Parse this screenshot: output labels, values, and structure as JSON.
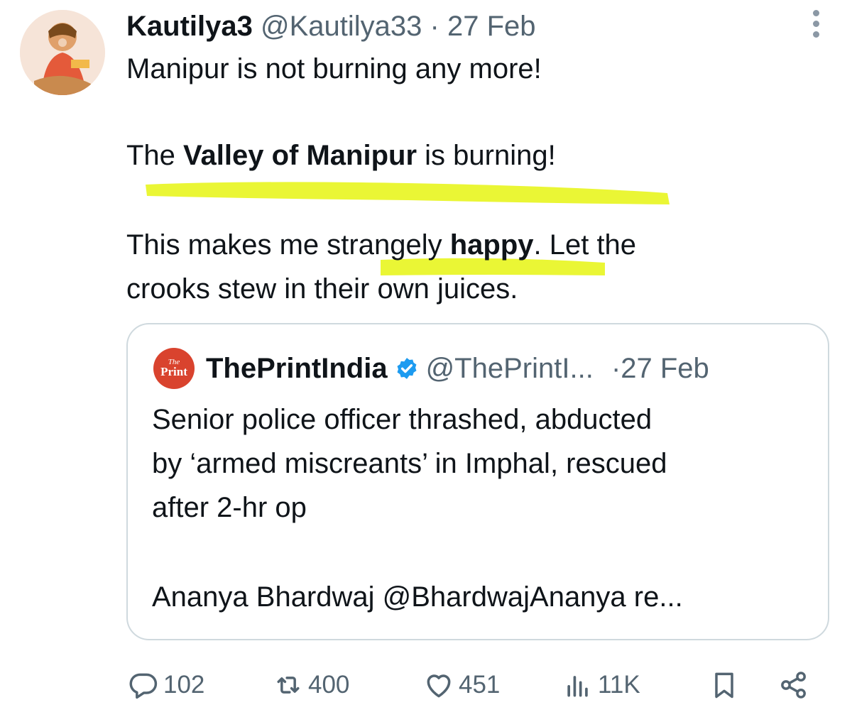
{
  "tweet": {
    "display_name": "Kautilya3",
    "handle": "@Kautilya33",
    "separator": "·",
    "date": "27 Feb",
    "lines": {
      "line1": "Manipur is not burning any more!",
      "line2_pre": "The ",
      "line2_bold": "Valley of Manipur",
      "line2_post": " is burning!",
      "line3_pre": "This makes me strangely ",
      "line3_bold": "happy",
      "line3_post": ". Let the",
      "line4": "crooks stew in their own juices."
    }
  },
  "quote": {
    "logo_text_top": "The",
    "logo_text_bottom": "Print",
    "display_name": "ThePrintIndia",
    "handle": "@ThePrintI...",
    "separator": "·",
    "date": "27 Feb",
    "lines": [
      "Senior police officer thrashed, abducted",
      "by ‘armed miscreants’ in Imphal, rescued",
      "after 2-hr op"
    ],
    "byline": "Ananya Bhardwaj @BhardwajAnanya re..."
  },
  "actions": {
    "replies": "102",
    "reposts": "400",
    "likes": "451",
    "views": "11K"
  },
  "icons": {
    "more": "more-vertical-icon",
    "verified": "verified-badge-icon",
    "reply": "reply-icon",
    "repost": "repost-icon",
    "like": "heart-icon",
    "views": "views-bar-icon",
    "bookmark": "bookmark-icon",
    "share": "share-icon"
  },
  "colors": {
    "highlight": "#e8f51f",
    "verified": "#1d9bf0",
    "logo": "#d9432e",
    "muted": "#536471"
  }
}
